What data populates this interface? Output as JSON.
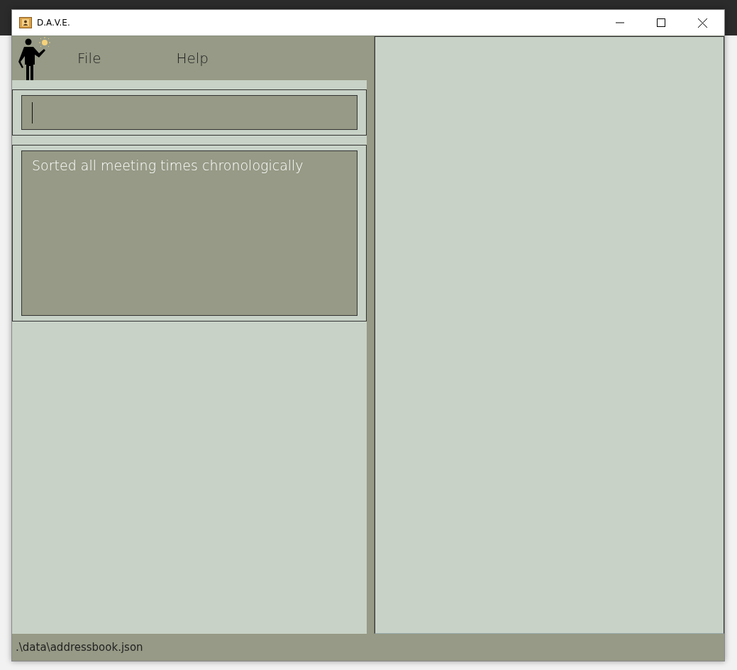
{
  "window": {
    "title": "D.A.V.E."
  },
  "menu": [
    {
      "label": "File"
    },
    {
      "label": "Help"
    }
  ],
  "result_display": {
    "text": "Sorted all meeting times chronologically"
  },
  "status_bar": {
    "path": ".\\data\\addressbook.json"
  }
}
